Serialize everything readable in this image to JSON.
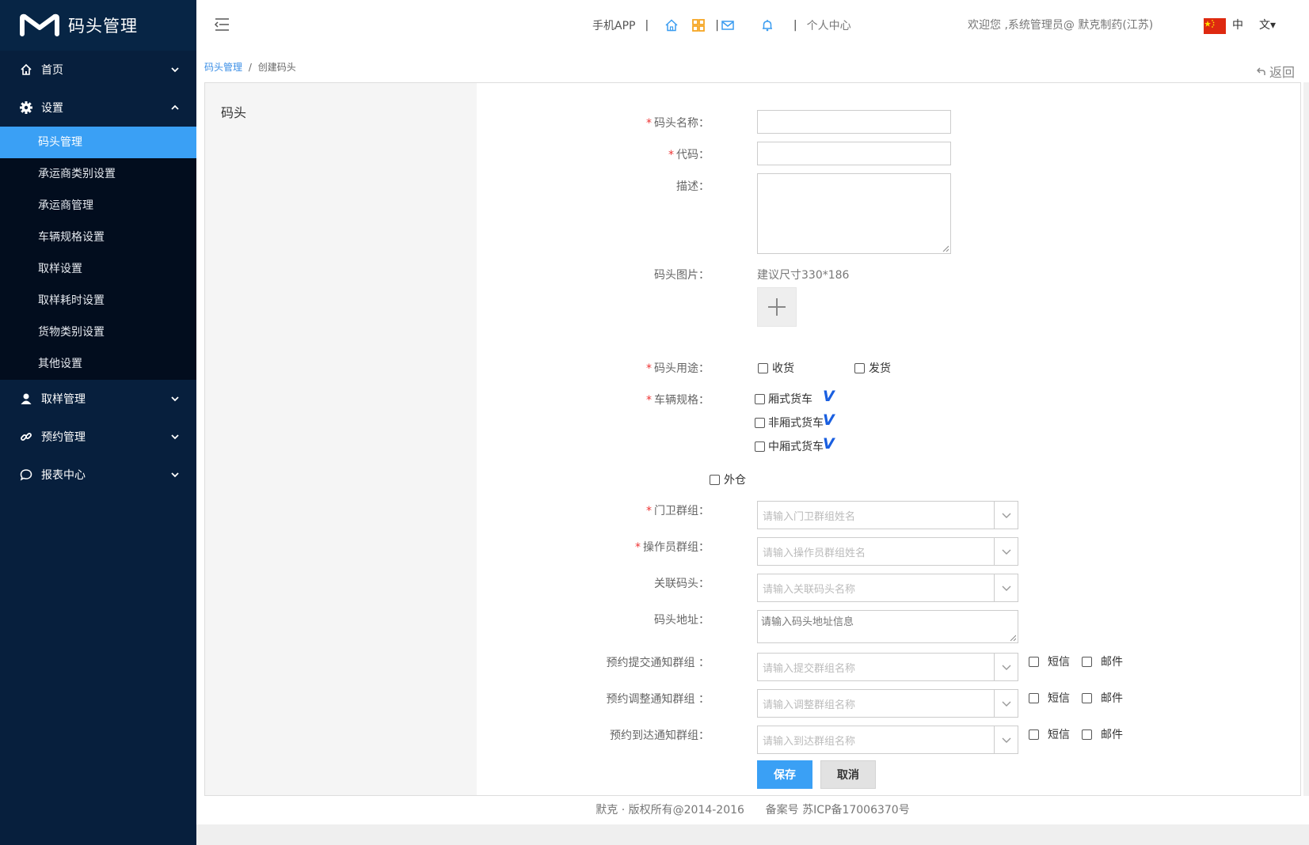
{
  "brand": {
    "title": "码头管理"
  },
  "sidebar": {
    "groups": [
      {
        "label": "首页",
        "icon": "home-icon",
        "expanded": false
      },
      {
        "label": "设置",
        "icon": "gear-icon",
        "expanded": true,
        "items": [
          {
            "label": "码头管理",
            "active": true
          },
          {
            "label": "承运商类别设置"
          },
          {
            "label": "承运商管理"
          },
          {
            "label": "车辆规格设置"
          },
          {
            "label": "取样设置"
          },
          {
            "label": "取样耗时设置"
          },
          {
            "label": "货物类别设置"
          },
          {
            "label": "其他设置"
          }
        ]
      },
      {
        "label": "取样管理",
        "icon": "user-icon",
        "expanded": false
      },
      {
        "label": "预约管理",
        "icon": "link-icon",
        "expanded": false
      },
      {
        "label": "报表中心",
        "icon": "chat-icon",
        "expanded": false
      }
    ]
  },
  "header": {
    "mobile_app": "手机APP",
    "sep": "|",
    "personal_center": "个人中心",
    "welcome": "欢迎您 ,系统管理员@ 默克制药(江苏)",
    "lang_current": "中",
    "lang_select": "文▾"
  },
  "breadcrumb": {
    "root": "码头管理",
    "sep": "/",
    "current": "创建码头"
  },
  "back_label": "返回",
  "panel": {
    "title": "码头"
  },
  "form": {
    "name_label": "码头名称：",
    "code_label": "代码：",
    "desc_label": "描述：",
    "image_label": "码头图片：",
    "image_hint": "建议尺寸330*186",
    "usage_label": "码头用途：",
    "usage_options": [
      "收货",
      "发货"
    ],
    "vehicle_label": "车辆规格：",
    "vehicle_options": [
      "厢式货车",
      "非厢式货车",
      "中厢式货车"
    ],
    "vehicle_mark": "V",
    "outer_warehouse": "外仓",
    "guard_label": "门卫群组：",
    "guard_placeholder": "请输入门卫群组姓名",
    "operator_label": "操作员群组：",
    "operator_placeholder": "请输入操作员群组姓名",
    "related_label": "关联码头：",
    "related_placeholder": "请输入关联码头名称",
    "address_label": "码头地址：",
    "address_placeholder": "请输入码头地址信息",
    "submit_notify_label": "预约提交通知群组 ：",
    "submit_notify_placeholder": "请输入提交群组名称",
    "adjust_notify_label": "预约调整通知群组 ：",
    "adjust_notify_placeholder": "请输入调整群组名称",
    "arrive_notify_label": "预约到达通知群组：",
    "arrive_notify_placeholder": "请输入到达群组名称",
    "sms_label": "短信",
    "mail_label": "邮件",
    "save_label": "保存",
    "cancel_label": "取消"
  },
  "footer": {
    "text": "默克 · 版权所有@2014-2016      备案号 苏ICP备17006370号"
  }
}
